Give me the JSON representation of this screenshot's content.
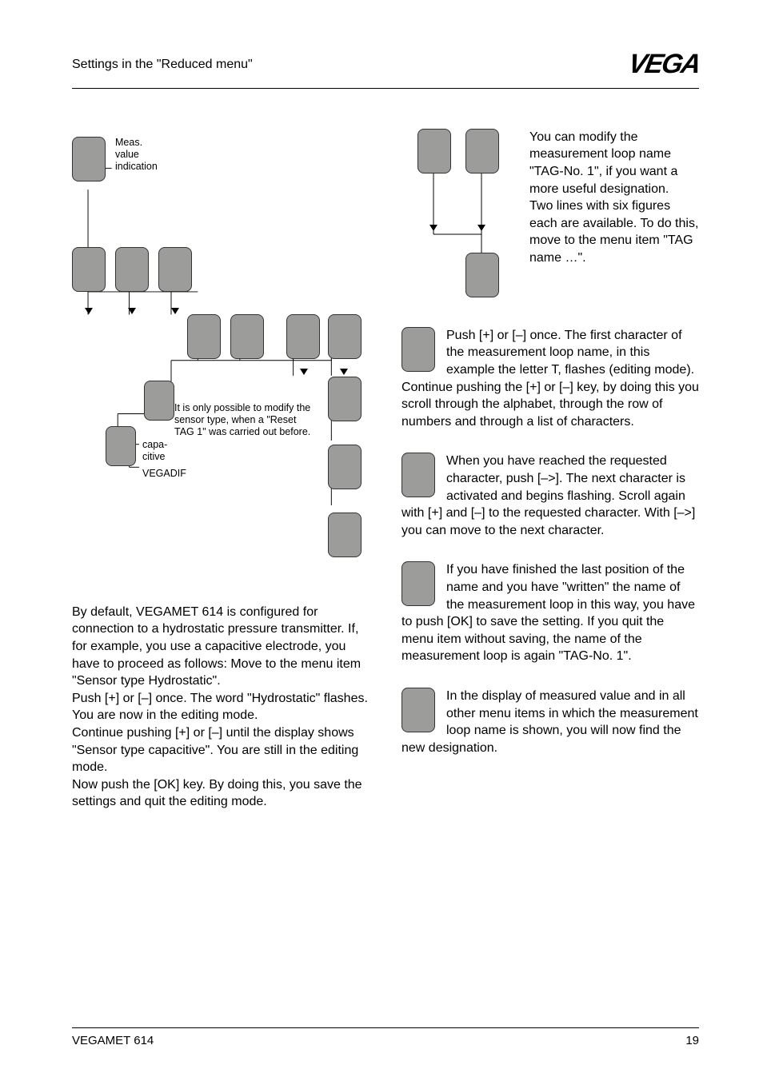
{
  "header": {
    "section_title": "Settings in the \"Reduced menu\"",
    "logo_text": "VEGA"
  },
  "left_diagram": {
    "label_meas": "Meas.\nvalue\nindication",
    "label_note": "It is only possible to modify the sensor type, when a \"Reset TAG 1\" was carried out before.",
    "label_capa": "capa-\ncitive",
    "label_vegadif": "VEGADIF"
  },
  "left_text": {
    "p1": "By default, VEGAMET 614 is configured for connection to a hydrostatic pressure transmitter. If, for example, you use a capacitive electrode, you have to proceed as follows: Move to the menu item \"Sensor type Hydrostatic\".",
    "p2": "Push [+] or [–] once. The word \"Hydrostatic\" flashes. You are now in the editing mode.",
    "p3": "Continue pushing [+] or [–] until the display shows \"Sensor type capacitive\". You are still in the editing mode.",
    "p4": "Now push the [OK] key. By doing this, you save the settings and quit the editing mode."
  },
  "right_blocks": {
    "intro": "You can modify the measurement loop name \"TAG-No. 1\", if you want a more useful designation.\nTwo lines with six figures each are available. To do this, move to the menu item \"TAG name …\".",
    "b1": "Push [+] or [–] once. The first character of the measurement loop name, in this example the letter T, flashes (editing mode). Continue pushing the [+] or [–] key, by doing this you scroll through the alphabet, through the row of numbers and through a list of characters.",
    "b2": "When you have reached the requested character, push [–>]. The next character is activated and begins flashing. Scroll again with [+] and [–] to the requested character. With [–>] you can move to the next character.",
    "b3": "If you have finished the last position of the name and you have \"written\" the name of the measurement loop in this way, you have to push [OK] to save the setting. If you quit the menu item without saving, the name of the measurement loop is again \"TAG-No. 1\".",
    "b4": "In the display of measured value and in all other menu items in which the measurement loop name is shown, you will now find the new designation."
  },
  "footer": {
    "product": "VEGAMET 614",
    "page": "19"
  }
}
